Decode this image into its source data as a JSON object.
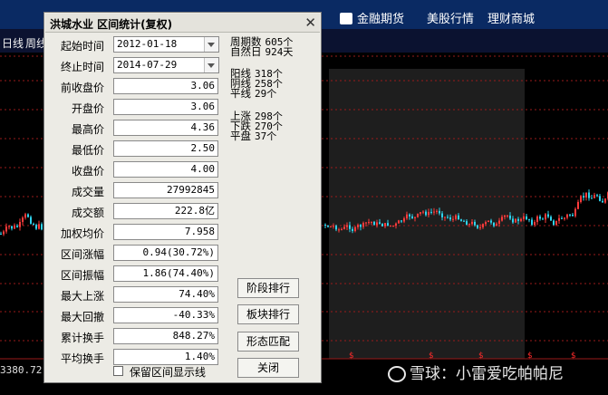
{
  "topbar": {
    "items": [
      {
        "label": "金融期货",
        "icon": "futures-icon"
      },
      {
        "label": "美股行情",
        "icon": ""
      },
      {
        "label": "理财商城",
        "icon": ""
      }
    ]
  },
  "subbar": {
    "left_labels": [
      "日线",
      "周线"
    ]
  },
  "chart": {
    "price_label": "3380.72",
    "watermark": "雪球：小雷爱吃帕帕尼",
    "colors": {
      "up": "#ff3b3b",
      "down": "#2fd4ee",
      "grid": "#9a1a1a",
      "highlight": "#1e1e1e"
    }
  },
  "dialog": {
    "title": "洪城水业 区间统计(复权)",
    "close_symbol": "✕",
    "fields": [
      {
        "label": "起始时间",
        "value": "2012-01-18"
      },
      {
        "label": "终止时间",
        "value": "2014-07-29"
      },
      {
        "label": "前收盘价",
        "value": "3.06"
      },
      {
        "label": "开盘价",
        "value": "3.06"
      },
      {
        "label": "最高价",
        "value": "4.36"
      },
      {
        "label": "最低价",
        "value": "2.50"
      },
      {
        "label": "收盘价",
        "value": "4.00"
      },
      {
        "label": "成交量",
        "value": "27992845"
      },
      {
        "label": "成交额",
        "value": "222.8亿"
      },
      {
        "label": "加权均价",
        "value": "7.958"
      },
      {
        "label": "区间涨幅",
        "value": "0.94(30.72%)"
      },
      {
        "label": "区间振幅",
        "value": "1.86(74.40%)"
      },
      {
        "label": "最大上涨",
        "value": "74.40%"
      },
      {
        "label": "最大回撤",
        "value": "-40.33%"
      },
      {
        "label": "累计换手",
        "value": "848.27%"
      },
      {
        "label": "平均换手",
        "value": "1.40%"
      }
    ],
    "stats": [
      {
        "label": "周期数",
        "value": "605个"
      },
      {
        "label": "自然日",
        "value": "924天"
      },
      {
        "label": "阳线",
        "value": "318个"
      },
      {
        "label": "阴线",
        "value": "258个"
      },
      {
        "label": "平线",
        "value": "29个"
      },
      {
        "label": "上涨",
        "value": "298个"
      },
      {
        "label": "下跌",
        "value": "270个"
      },
      {
        "label": "平盘",
        "value": "37个"
      }
    ],
    "buttons": {
      "rank_stage": "阶段排行",
      "rank_sector": "板块排行",
      "pattern_match": "形态匹配",
      "close": "关闭"
    },
    "checkbox_label": "保留区间显示线"
  }
}
